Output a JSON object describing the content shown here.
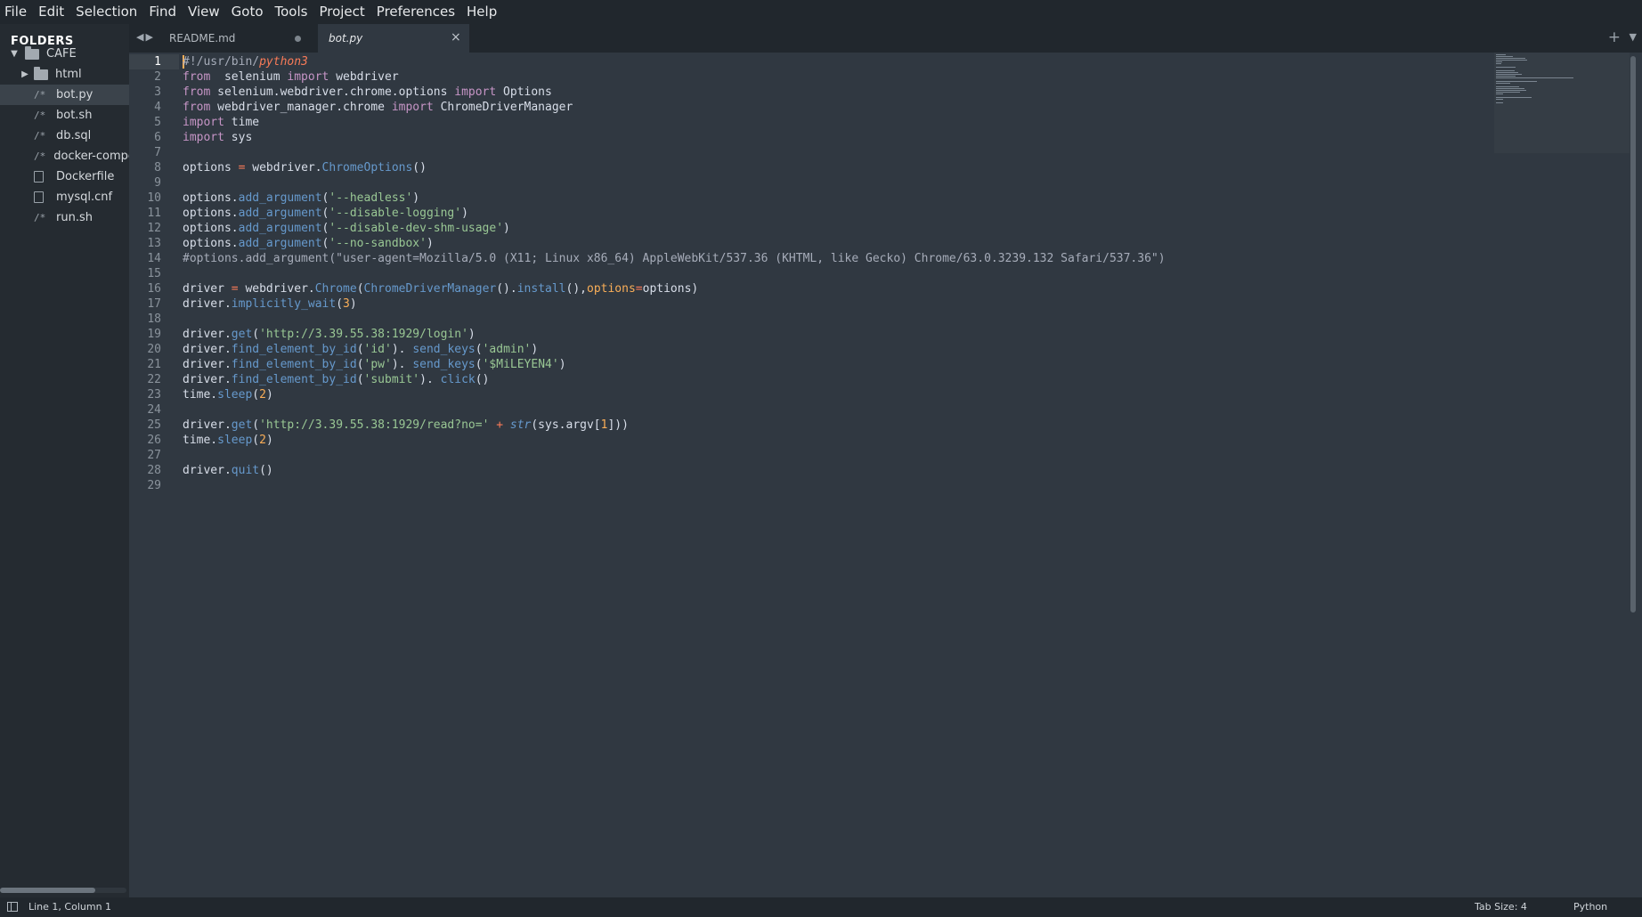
{
  "menu": [
    "File",
    "Edit",
    "Selection",
    "Find",
    "View",
    "Goto",
    "Tools",
    "Project",
    "Preferences",
    "Help"
  ],
  "sidebar": {
    "header": "FOLDERS",
    "root": "CAFE",
    "items": [
      {
        "label": "html",
        "type": "folder"
      },
      {
        "label": "bot.py",
        "type": "code",
        "icon": "/*",
        "selected": true
      },
      {
        "label": "bot.sh",
        "type": "code",
        "icon": "/*"
      },
      {
        "label": "db.sql",
        "type": "code",
        "icon": "/*"
      },
      {
        "label": "docker-compo",
        "type": "code",
        "icon": "/*"
      },
      {
        "label": "Dockerfile",
        "type": "file"
      },
      {
        "label": "mysql.cnf",
        "type": "file"
      },
      {
        "label": "run.sh",
        "type": "code",
        "icon": "/*"
      }
    ]
  },
  "tabs": [
    {
      "label": "README.md",
      "active": false,
      "dirty": true
    },
    {
      "label": "bot.py",
      "active": true,
      "dirty": false
    }
  ],
  "tab_close_glyph": "×",
  "tab_plus_glyph": "+",
  "tab_dropdown_glyph": "▼",
  "code_lines": [
    [
      [
        "cursor",
        ""
      ],
      [
        "cm",
        "#!/usr/bin/"
      ],
      [
        "op it",
        "python3"
      ]
    ],
    [
      [
        "kw",
        "from"
      ],
      [
        "",
        "  selenium "
      ],
      [
        "kw",
        "import"
      ],
      [
        "",
        " webdriver"
      ]
    ],
    [
      [
        "kw",
        "from"
      ],
      [
        "",
        " selenium.webdriver.chrome.options "
      ],
      [
        "kw",
        "import"
      ],
      [
        "",
        " Options"
      ]
    ],
    [
      [
        "kw",
        "from"
      ],
      [
        "",
        " webdriver_manager.chrome "
      ],
      [
        "kw",
        "import"
      ],
      [
        "",
        " ChromeDriverManager"
      ]
    ],
    [
      [
        "kw",
        "import"
      ],
      [
        "",
        " time"
      ]
    ],
    [
      [
        "kw",
        "import"
      ],
      [
        "",
        " sys"
      ]
    ],
    [],
    [
      [
        "",
        "options "
      ],
      [
        "op",
        "="
      ],
      [
        "",
        " webdriver."
      ],
      [
        "fn",
        "ChromeOptions"
      ],
      [
        "",
        "()"
      ]
    ],
    [],
    [
      [
        "",
        "options."
      ],
      [
        "fn",
        "add_argument"
      ],
      [
        "",
        "("
      ],
      [
        "str",
        "'--headless'"
      ],
      [
        "",
        ")"
      ]
    ],
    [
      [
        "",
        "options."
      ],
      [
        "fn",
        "add_argument"
      ],
      [
        "",
        "("
      ],
      [
        "str",
        "'--disable-logging'"
      ],
      [
        "",
        ")"
      ]
    ],
    [
      [
        "",
        "options."
      ],
      [
        "fn",
        "add_argument"
      ],
      [
        "",
        "("
      ],
      [
        "str",
        "'--disable-dev-shm-usage'"
      ],
      [
        "",
        ")"
      ]
    ],
    [
      [
        "",
        "options."
      ],
      [
        "fn",
        "add_argument"
      ],
      [
        "",
        "("
      ],
      [
        "str",
        "'--no-sandbox'"
      ],
      [
        "",
        ")"
      ]
    ],
    [
      [
        "cm",
        "#options.add_argument(\"user-agent=Mozilla/5.0 (X11; Linux x86_64) AppleWebKit/537.36 (KHTML, like Gecko) Chrome/63.0.3239.132 Safari/537.36\")"
      ]
    ],
    [],
    [
      [
        "",
        "driver "
      ],
      [
        "op",
        "="
      ],
      [
        "",
        " webdriver."
      ],
      [
        "fn",
        "Chrome"
      ],
      [
        "",
        "("
      ],
      [
        "fn",
        "ChromeDriverManager"
      ],
      [
        "",
        "()."
      ],
      [
        "fn",
        "install"
      ],
      [
        "",
        "(),"
      ],
      [
        "par",
        "options"
      ],
      [
        "op",
        "="
      ],
      [
        "",
        "options)"
      ]
    ],
    [
      [
        "",
        "driver."
      ],
      [
        "fn",
        "implicitly_wait"
      ],
      [
        "",
        "("
      ],
      [
        "par",
        "3"
      ],
      [
        "",
        ")"
      ]
    ],
    [],
    [
      [
        "",
        "driver."
      ],
      [
        "fn",
        "get"
      ],
      [
        "",
        "("
      ],
      [
        "str",
        "'http://3.39.55.38:1929/login'"
      ],
      [
        "",
        ")"
      ]
    ],
    [
      [
        "",
        "driver."
      ],
      [
        "fn",
        "find_element_by_id"
      ],
      [
        "",
        "("
      ],
      [
        "str",
        "'id'"
      ],
      [
        "",
        "). "
      ],
      [
        "fn",
        "send_keys"
      ],
      [
        "",
        "("
      ],
      [
        "str",
        "'admin'"
      ],
      [
        "",
        ")"
      ]
    ],
    [
      [
        "",
        "driver."
      ],
      [
        "fn",
        "find_element_by_id"
      ],
      [
        "",
        "("
      ],
      [
        "str",
        "'pw'"
      ],
      [
        "",
        "). "
      ],
      [
        "fn",
        "send_keys"
      ],
      [
        "",
        "("
      ],
      [
        "str",
        "'$MiLEYEN4'"
      ],
      [
        "",
        ")"
      ]
    ],
    [
      [
        "",
        "driver."
      ],
      [
        "fn",
        "find_element_by_id"
      ],
      [
        "",
        "("
      ],
      [
        "str",
        "'submit'"
      ],
      [
        "",
        "). "
      ],
      [
        "fn",
        "click"
      ],
      [
        "",
        "()"
      ]
    ],
    [
      [
        "",
        "time."
      ],
      [
        "fn",
        "sleep"
      ],
      [
        "",
        "("
      ],
      [
        "par",
        "2"
      ],
      [
        "",
        ")"
      ]
    ],
    [],
    [
      [
        "",
        "driver."
      ],
      [
        "fn",
        "get"
      ],
      [
        "",
        "("
      ],
      [
        "str",
        "'http://3.39.55.38:1929/read?no='"
      ],
      [
        "",
        " "
      ],
      [
        "op",
        "+"
      ],
      [
        "",
        " "
      ],
      [
        "bi",
        "str"
      ],
      [
        "",
        "(sys.argv["
      ],
      [
        "par",
        "1"
      ],
      [
        "",
        "]))"
      ]
    ],
    [
      [
        "",
        "time."
      ],
      [
        "fn",
        "sleep"
      ],
      [
        "",
        "("
      ],
      [
        "par",
        "2"
      ],
      [
        "",
        ")"
      ]
    ],
    [],
    [
      [
        "",
        "driver."
      ],
      [
        "fn",
        "quit"
      ],
      [
        "",
        "()"
      ]
    ],
    []
  ],
  "status": {
    "position": "Line 1, Column 1",
    "tab_size": "Tab Size: 4",
    "syntax": "Python"
  }
}
